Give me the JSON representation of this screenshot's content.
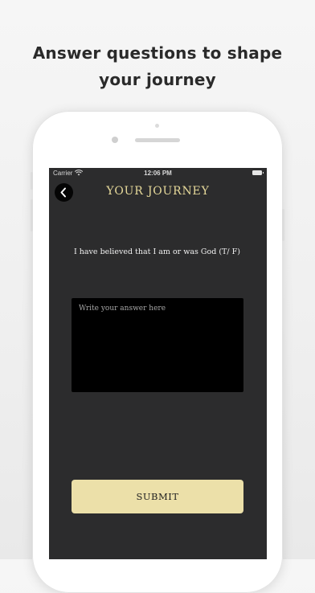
{
  "promo": {
    "headline_line1": "Answer questions to shape",
    "headline_line2": "your journey"
  },
  "status_bar": {
    "carrier": "Carrier",
    "time": "12:06 PM",
    "wifi_icon": "wifi-icon",
    "battery_icon": "battery-icon"
  },
  "nav": {
    "back_icon": "chevron-left-icon",
    "title": "YOUR JOURNEY"
  },
  "question": {
    "text": "I have believed that I am or was God (T/ F)"
  },
  "answer": {
    "value": "",
    "placeholder": "Write your answer here"
  },
  "actions": {
    "submit_label": "SUBMIT"
  },
  "colors": {
    "screen_background": "#2c2c2d",
    "title_gold": "#e6d99a",
    "button_cream": "#ece0a9",
    "input_background": "#000000"
  }
}
